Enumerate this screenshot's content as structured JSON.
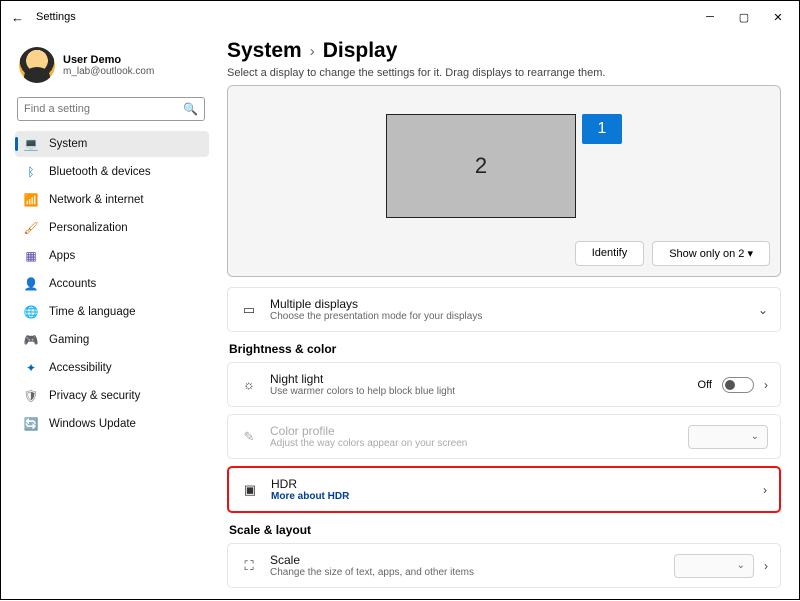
{
  "window": {
    "title": "Settings"
  },
  "user": {
    "name": "User Demo",
    "email": "m_lab@outlook.com"
  },
  "search": {
    "placeholder": "Find a setting"
  },
  "nav": [
    {
      "label": "System"
    },
    {
      "label": "Bluetooth & devices"
    },
    {
      "label": "Network & internet"
    },
    {
      "label": "Personalization"
    },
    {
      "label": "Apps"
    },
    {
      "label": "Accounts"
    },
    {
      "label": "Time & language"
    },
    {
      "label": "Gaming"
    },
    {
      "label": "Accessibility"
    },
    {
      "label": "Privacy & security"
    },
    {
      "label": "Windows Update"
    }
  ],
  "breadcrumb": {
    "a": "System",
    "b": "Display"
  },
  "subline": "Select a display to change the settings for it. Drag displays to rearrange them.",
  "monitors": {
    "primary": "2",
    "secondary": "1"
  },
  "arrange": {
    "identify": "Identify",
    "showonly": "Show only on 2"
  },
  "cards": {
    "multidisp": {
      "title": "Multiple displays",
      "sub": "Choose the presentation mode for your displays"
    },
    "nightlight": {
      "title": "Night light",
      "sub": "Use warmer colors to help block blue light",
      "state": "Off"
    },
    "colorprofile": {
      "title": "Color profile",
      "sub": "Adjust the way colors appear on your screen"
    },
    "hdr": {
      "title": "HDR",
      "sub": "More about HDR"
    },
    "scale": {
      "title": "Scale",
      "sub": "Change the size of text, apps, and other items"
    }
  },
  "sections": {
    "bright": "Brightness & color",
    "scale": "Scale & layout"
  }
}
